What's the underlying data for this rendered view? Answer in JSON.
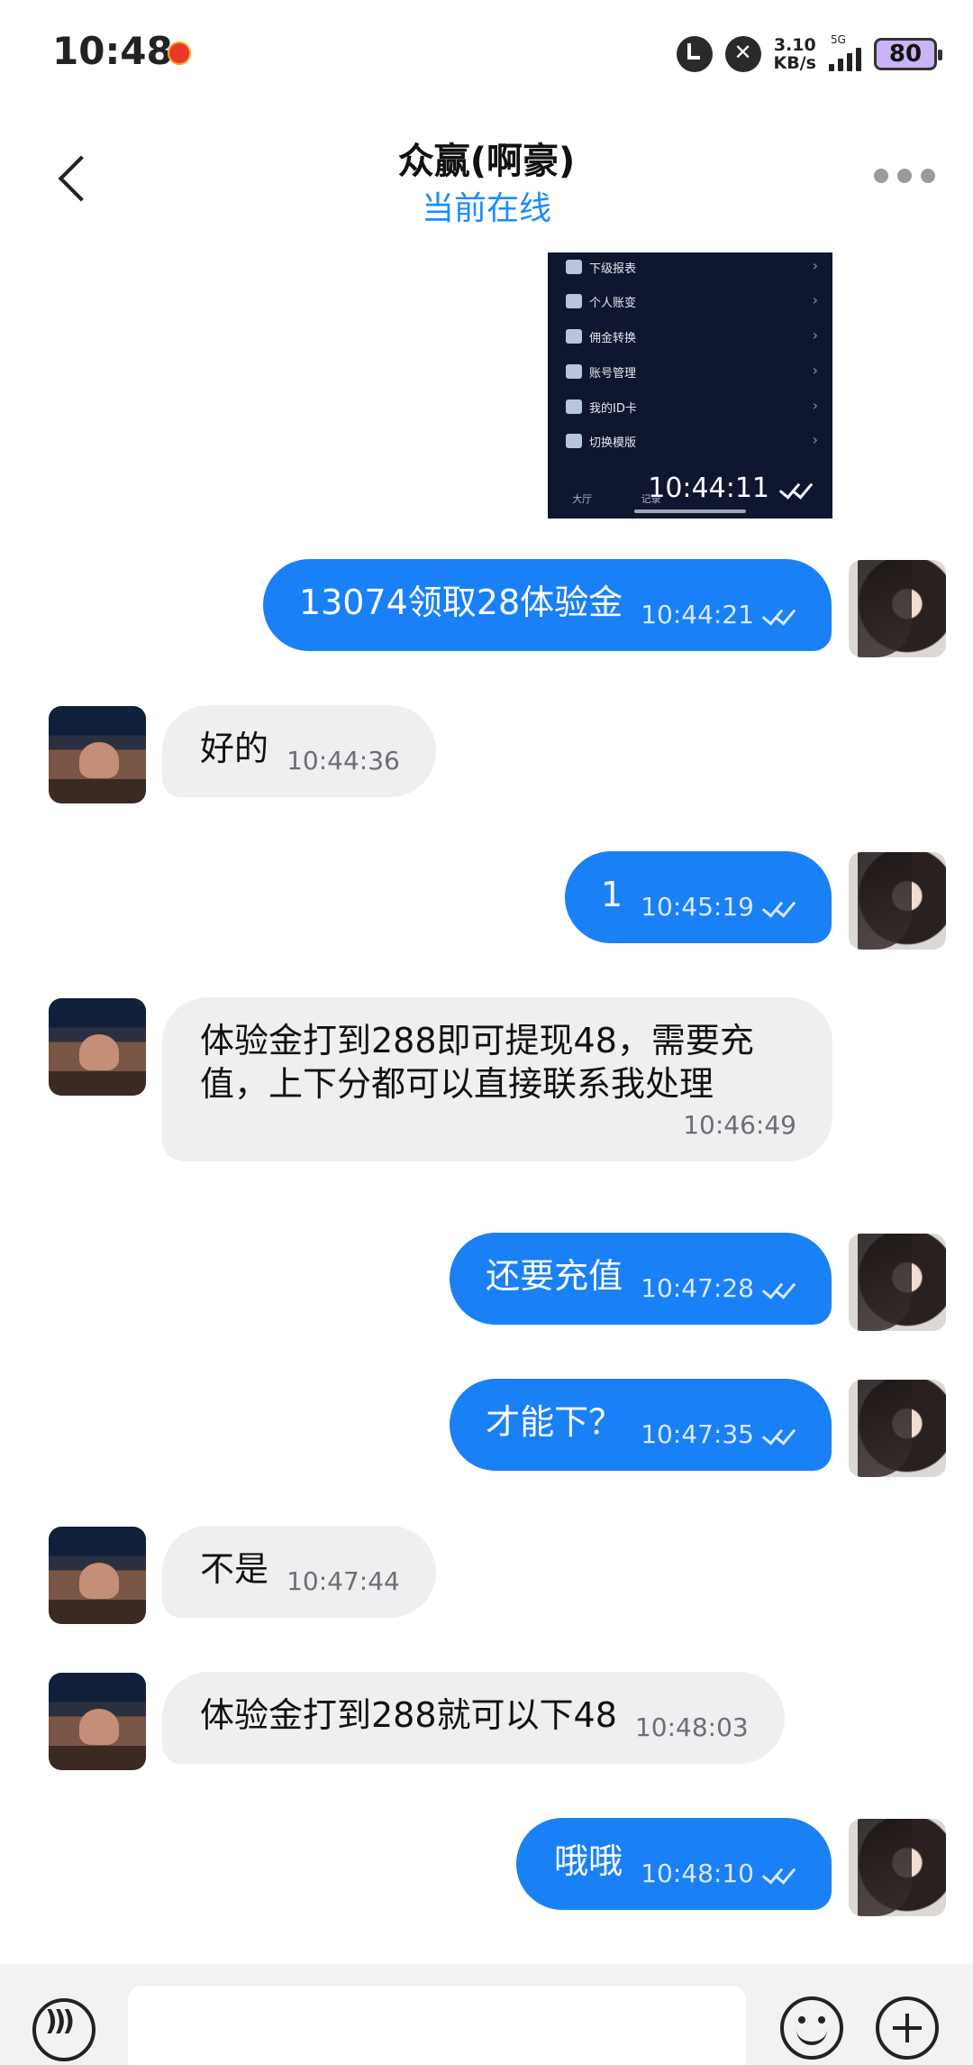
{
  "status_bar": {
    "time": "10:48",
    "speed_value": "3.10",
    "speed_unit": "KB/s",
    "network": "5G",
    "battery": "80"
  },
  "header": {
    "title": "众赢(啊豪)",
    "status": "当前在线"
  },
  "shared_image": {
    "menu_items": [
      {
        "label": "下级报表",
        "icon": "users-icon"
      },
      {
        "label": "个人账变",
        "icon": "list-icon"
      },
      {
        "label": "佣金转换",
        "icon": "money-bag-icon"
      },
      {
        "label": "账号管理",
        "icon": "gear-icon"
      },
      {
        "label": "我的ID卡",
        "icon": "id-card-icon"
      },
      {
        "label": "切换模版",
        "icon": "list-icon"
      }
    ],
    "tabs": [
      "大厅",
      "记录",
      "",
      "",
      ""
    ],
    "timestamp": "10:44:11"
  },
  "messages": [
    {
      "sender": "me",
      "text": "13074领取28体验金",
      "time": "10:44:21"
    },
    {
      "sender": "them",
      "text": "好的",
      "time": "10:44:36"
    },
    {
      "sender": "me",
      "text": "1",
      "time": "10:45:19"
    },
    {
      "sender": "them",
      "text": "体验金打到288即可提现48，需要充值，上下分都可以直接联系我处理",
      "time": "10:46:49"
    },
    {
      "sender": "me",
      "text": "还要充值",
      "time": "10:47:28"
    },
    {
      "sender": "me",
      "text": "才能下？",
      "time": "10:47:35"
    },
    {
      "sender": "them",
      "text": "不是",
      "time": "10:47:44"
    },
    {
      "sender": "them",
      "text": "体验金打到288就可以下48",
      "time": "10:48:03"
    },
    {
      "sender": "me",
      "text": "哦哦",
      "time": "10:48:10"
    }
  ],
  "input": {
    "placeholder": ""
  },
  "colors": {
    "outgoing_bubble": "#1a80f6",
    "incoming_bubble": "#efeff1",
    "online_status": "#1a8cff"
  }
}
